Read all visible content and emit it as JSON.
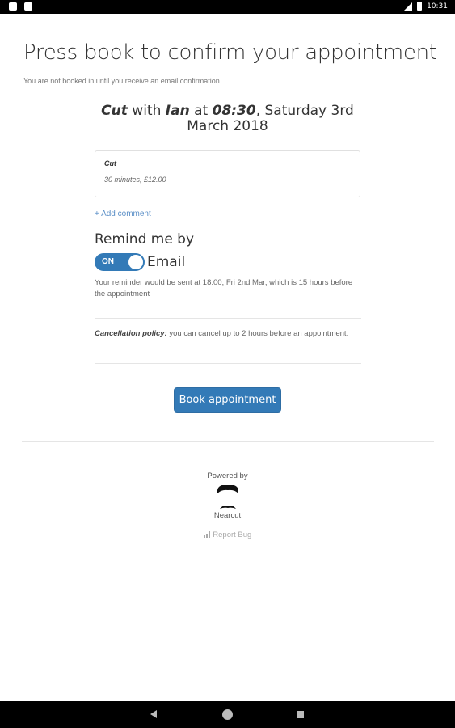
{
  "status_bar": {
    "time": "10:31"
  },
  "page": {
    "heading": "Press book to confirm your appointment",
    "subnote": "You are not booked in until you receive an email confirmation"
  },
  "appointment": {
    "service": "Cut",
    "with_word": " with ",
    "stylist": "Ian",
    "at_word": " at ",
    "time": "08:30",
    "date": ", Saturday 3rd March 2018"
  },
  "service_card": {
    "name": "Cut",
    "meta": "30 minutes, £12.00"
  },
  "add_comment": "+ Add comment",
  "reminder": {
    "title": "Remind me by",
    "toggle_state": "ON",
    "toggle_on": true,
    "channel": "Email",
    "note": "Your reminder would be sent at 18:00, Fri 2nd Mar, which is 15 hours before the appointment"
  },
  "policy": {
    "label": "Cancellation policy:",
    "text": " you can cancel up to 2 hours before an appointment."
  },
  "book_button": "Book appointment",
  "footer": {
    "powered_by": "Powered by",
    "brand": "Nearcut",
    "report_bug": "Report Bug"
  },
  "colors": {
    "accent": "#337ab7",
    "link": "#5b8fc7"
  },
  "icons": {
    "nav_back": "back-triangle-icon",
    "nav_home": "home-circle-icon",
    "nav_recent": "recent-square-icon",
    "report": "signal-icon"
  }
}
